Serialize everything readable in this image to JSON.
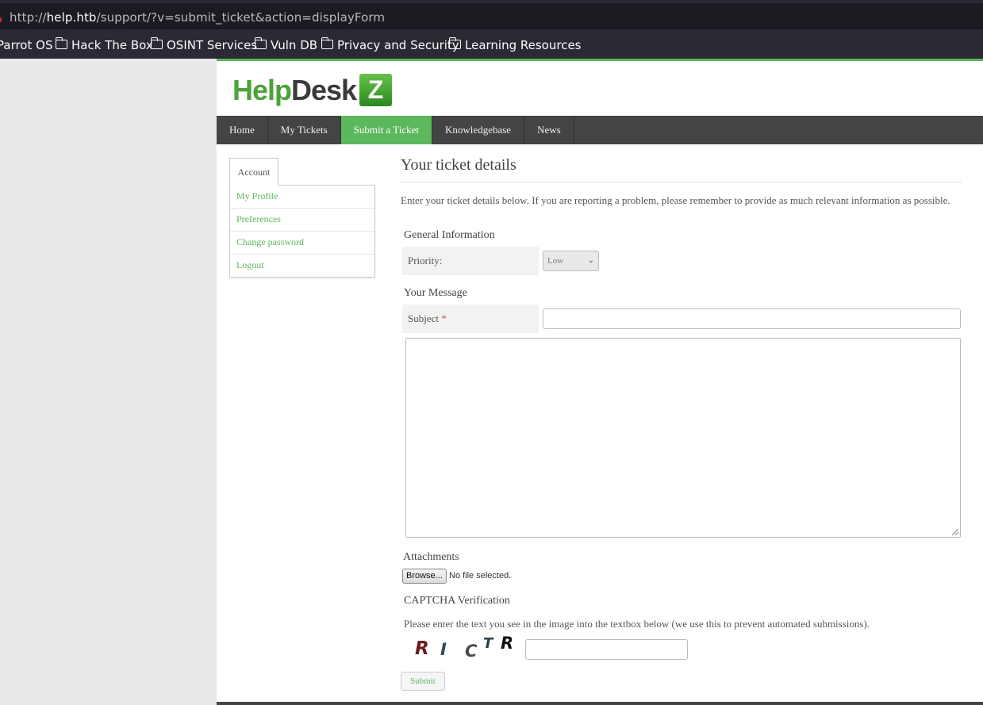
{
  "browser": {
    "url_prefix": "http://",
    "url_host": "help.htb",
    "url_path": "/support/?v=submit_ticket&action=displayForm",
    "bookmarks": [
      "Parrot OS",
      "Hack The Box",
      "OSINT Services",
      "Vuln DB",
      "Privacy and Security",
      "Learning Resources"
    ]
  },
  "logo": {
    "help": "Help",
    "desk": "Desk",
    "z": "Z"
  },
  "nav": {
    "items": [
      {
        "label": "Home"
      },
      {
        "label": "My Tickets"
      },
      {
        "label": "Submit a Ticket",
        "active": true
      },
      {
        "label": "Knowledgebase"
      },
      {
        "label": "News"
      }
    ]
  },
  "sidebar": {
    "tab": "Account",
    "links": [
      "My Profile",
      "Preferences",
      "Change password",
      "Logout"
    ]
  },
  "form": {
    "title": "Your ticket details",
    "intro": "Enter your ticket details below. If you are reporting a problem, please remember to provide as much relevant information as possible.",
    "general_title": "General Information",
    "priority_label": "Priority:",
    "priority_value": "Low",
    "message_title": "Your Message",
    "subject_label": "Subject",
    "subject_required": "*",
    "subject_value": "",
    "message_value": "",
    "attachments_title": "Attachments",
    "browse_label": "Browse...",
    "no_file": "No file selected.",
    "captcha_title": "CAPTCHA Verification",
    "captcha_instructions": "Please enter the text you see in the image into the textbox below (we use this to prevent automated submissions).",
    "captcha_chars": [
      "R",
      "I",
      "C",
      "T",
      "R"
    ],
    "captcha_value": "",
    "submit_label": "Submit"
  },
  "colors": {
    "accent": "#5cb85c",
    "nav_bg": "#444444",
    "required": "#d9534f"
  }
}
